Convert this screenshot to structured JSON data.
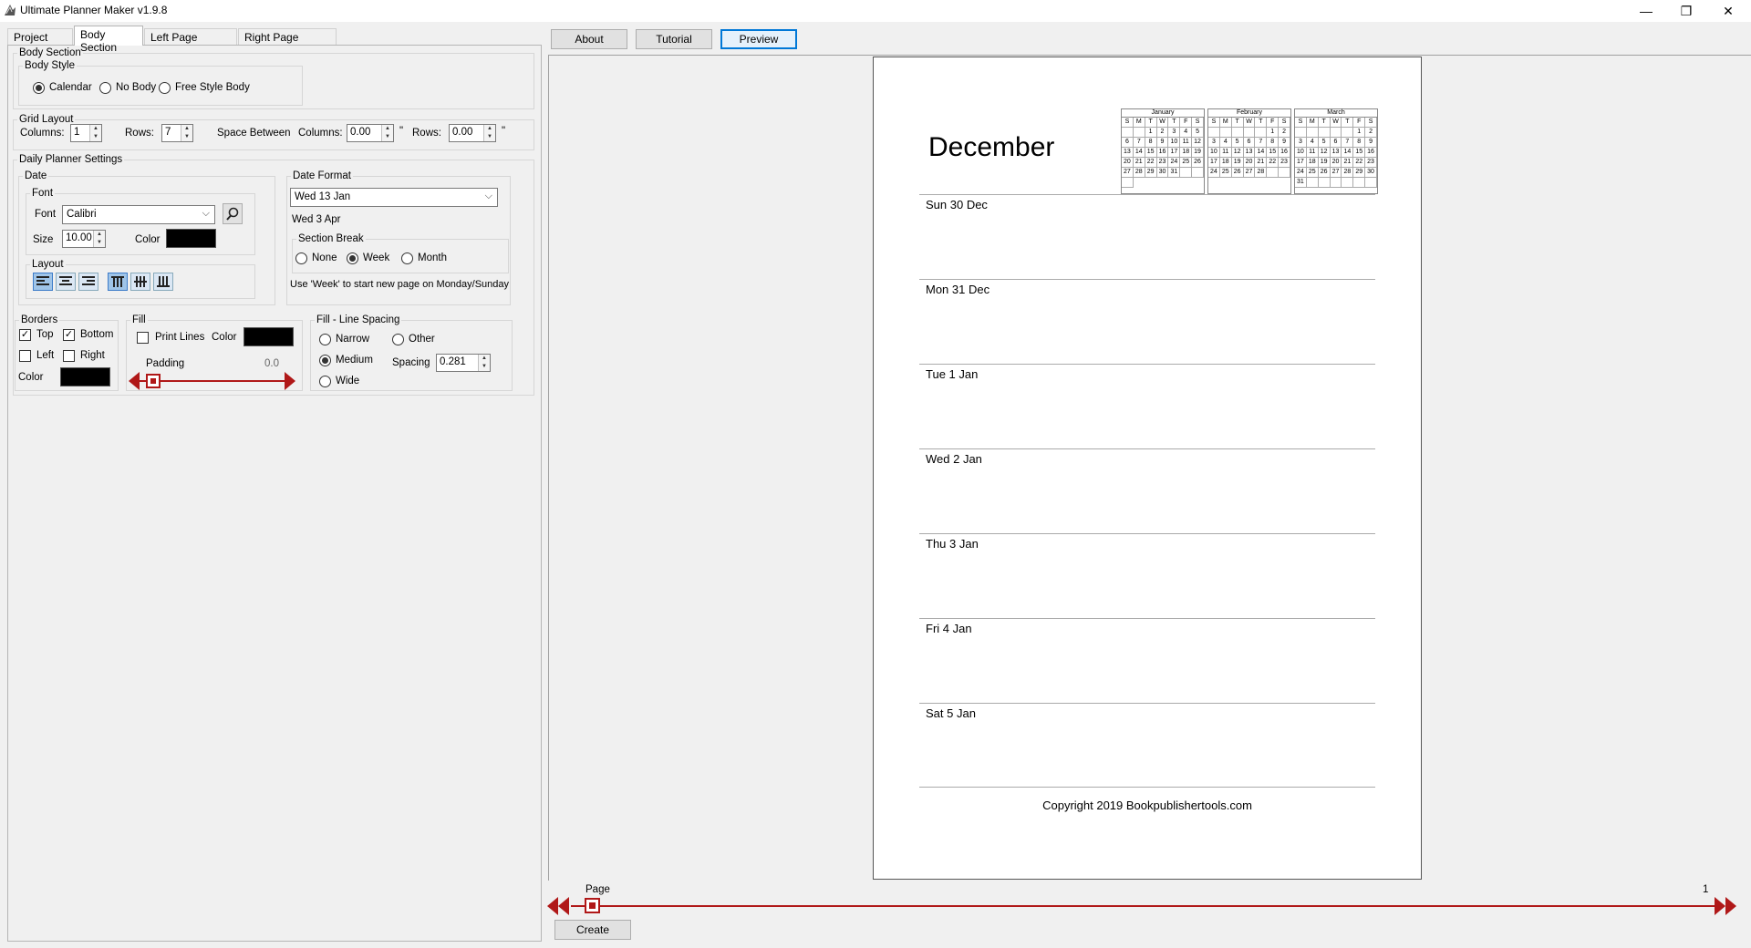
{
  "app": {
    "title": "Ultimate Planner Maker v1.9.8"
  },
  "window": {
    "minimize": "—",
    "restore": "❐",
    "close": "✕"
  },
  "tabs": [
    "Project Setup",
    "Body Section",
    "Left Page Sections",
    "Right Page Sections"
  ],
  "body_section": {
    "group_title": "Body Section",
    "body_style": {
      "title": "Body Style",
      "options": [
        "Calendar",
        "No Body",
        "Free Style Body"
      ],
      "selected": "Calendar"
    }
  },
  "grid_layout": {
    "title": "Grid Layout",
    "columns_label": "Columns:",
    "columns_value": "1",
    "rows_label": "Rows:",
    "rows_value": "7",
    "space_between_label": "Space Between",
    "sb_columns_label": "Columns:",
    "sb_columns_value": "0.00",
    "sb_rows_label": "Rows:",
    "sb_rows_value": "0.00",
    "unit": "\""
  },
  "daily": {
    "title": "Daily Planner Settings",
    "date_title": "Date",
    "font_title": "Font",
    "font_label": "Font",
    "font_value": "Calibri",
    "size_label": "Size",
    "size_value": "10.00",
    "color_label": "Color",
    "layout_title": "Layout",
    "date_format_title": "Date Format",
    "date_format_value": "Wed 13 Jan",
    "date_format_sample": "Wed 3 Apr",
    "section_break_title": "Section Break",
    "section_break_options": [
      "None",
      "Week",
      "Month"
    ],
    "section_break_selected": "Week",
    "hint": "Use 'Week' to start new page on Monday/Sunday"
  },
  "borders": {
    "title": "Borders",
    "top": "Top",
    "bottom": "Bottom",
    "left": "Left",
    "right": "Right",
    "color_label": "Color",
    "checked": {
      "top": true,
      "bottom": true,
      "left": false,
      "right": false
    }
  },
  "fill": {
    "title": "Fill",
    "print_lines": "Print Lines",
    "color_label": "Color",
    "padding_label": "Padding",
    "padding_value": "0.0"
  },
  "fill_spacing": {
    "title": "Fill - Line Spacing",
    "options": [
      "Narrow",
      "Other",
      "Medium",
      "Wide"
    ],
    "selected": "Medium",
    "spacing_label": "Spacing",
    "spacing_value": "0.281"
  },
  "top_buttons": {
    "about": "About",
    "tutorial": "Tutorial",
    "preview": "Preview"
  },
  "preview": {
    "month": "December",
    "mini_calendars": [
      {
        "name": "January",
        "days": [
          "S",
          "M",
          "T",
          "W",
          "T",
          "F",
          "S",
          "",
          "",
          "1",
          "2",
          "3",
          "4",
          "5",
          "6",
          "7",
          "8",
          "9",
          "10",
          "11",
          "12",
          "13",
          "14",
          "15",
          "16",
          "17",
          "18",
          "19",
          "20",
          "21",
          "22",
          "23",
          "24",
          "25",
          "26",
          "27",
          "28",
          "29",
          "30",
          "31",
          "",
          "",
          ""
        ]
      },
      {
        "name": "February",
        "days": [
          "S",
          "M",
          "T",
          "W",
          "T",
          "F",
          "S",
          "",
          "",
          "",
          "",
          "",
          "1",
          "2",
          "3",
          "4",
          "5",
          "6",
          "7",
          "8",
          "9",
          "10",
          "11",
          "12",
          "13",
          "14",
          "15",
          "16",
          "17",
          "18",
          "19",
          "20",
          "21",
          "22",
          "23",
          "24",
          "25",
          "26",
          "27",
          "28",
          "",
          ""
        ]
      },
      {
        "name": "March",
        "days": [
          "S",
          "M",
          "T",
          "W",
          "T",
          "F",
          "S",
          "",
          "",
          "",
          "",
          "",
          "1",
          "2",
          "3",
          "4",
          "5",
          "6",
          "7",
          "8",
          "9",
          "10",
          "11",
          "12",
          "13",
          "14",
          "15",
          "16",
          "17",
          "18",
          "19",
          "20",
          "21",
          "22",
          "23",
          "24",
          "25",
          "26",
          "27",
          "28",
          "29",
          "30",
          "31",
          "",
          "",
          "",
          "",
          "",
          ""
        ]
      }
    ],
    "days": [
      "Sun 30 Dec",
      "Mon 31 Dec",
      "Tue 1 Jan",
      "Wed 2 Jan",
      "Thu 3 Jan",
      "Fri 4 Jan",
      "Sat 5 Jan"
    ],
    "copyright": "Copyright 2019 Bookpublishertools.com"
  },
  "pager": {
    "label": "Page",
    "value": "1",
    "create": "Create"
  },
  "colors": {
    "accent_red": "#b01818",
    "selection_blue": "#0078d7"
  }
}
